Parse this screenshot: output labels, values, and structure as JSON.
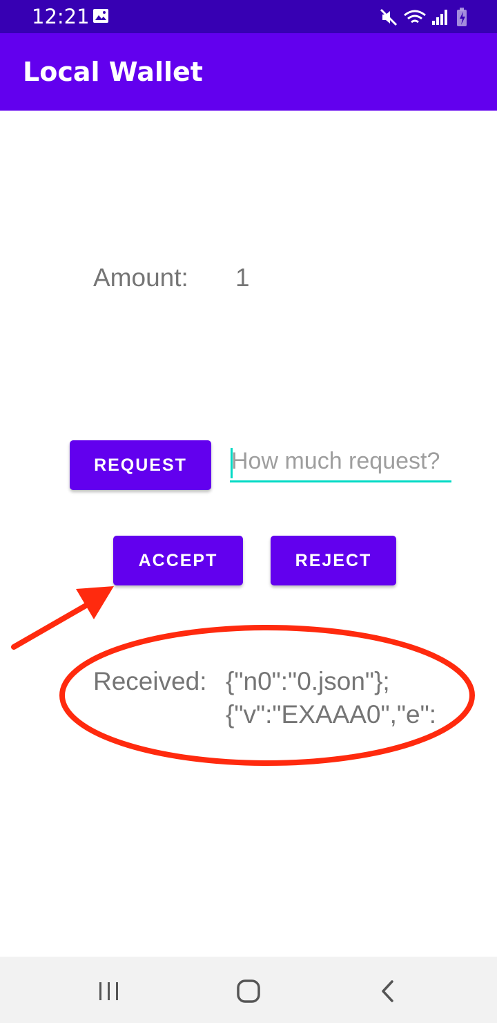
{
  "status_bar": {
    "time": "12:21",
    "icons": [
      "image-icon",
      "mute-icon",
      "wifi-icon",
      "signal-icon",
      "battery-charging-icon"
    ]
  },
  "app_bar": {
    "title": "Local Wallet",
    "color": "#6200ee",
    "status_color": "#3700b3"
  },
  "amount": {
    "label": "Amount:",
    "value": "1"
  },
  "request": {
    "button_label": "REQUEST",
    "input_value": "",
    "input_placeholder": "How much request?"
  },
  "actions": {
    "accept_label": "ACCEPT",
    "reject_label": "REJECT"
  },
  "received": {
    "label": "Received:",
    "lines": [
      "{\"n0\":\"0.json\"};",
      "{\"v\":\"EXAAA0\",\"e\":"
    ]
  },
  "annotation": {
    "color": "#ff2a0e",
    "shapes": [
      "arrow-pointing-to-accept",
      "ellipse-around-received"
    ]
  },
  "nav_bar": {
    "buttons": [
      "recents-icon",
      "home-icon",
      "back-icon"
    ]
  }
}
